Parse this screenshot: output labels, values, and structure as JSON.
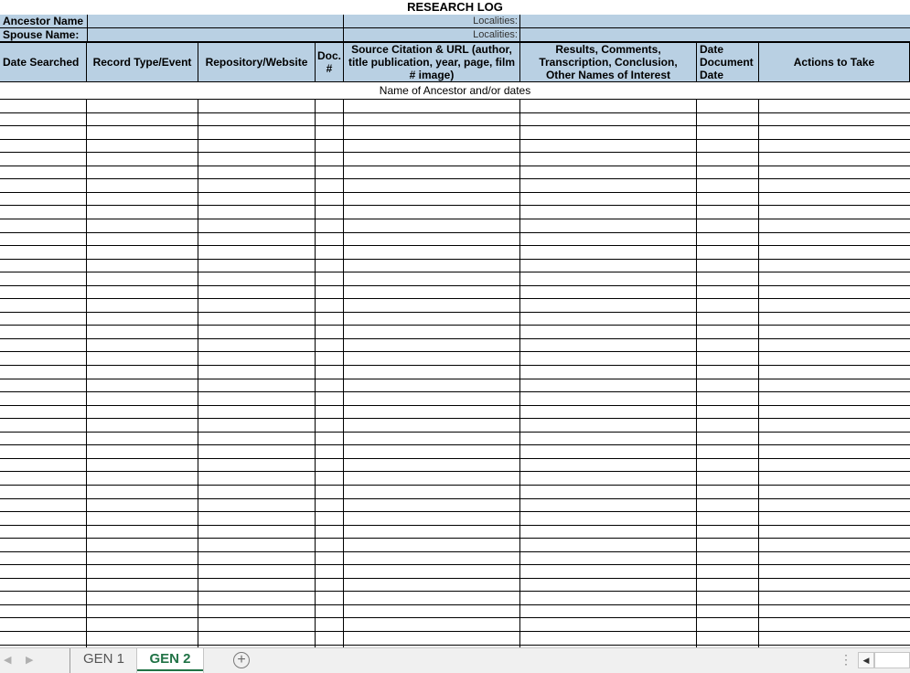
{
  "sheet": {
    "title": "RESEARCH LOG",
    "ancestor_label": "Ancestor Name",
    "spouse_label": "Spouse Name:",
    "localities_label_1": "Localities:",
    "localities_label_2": "Localities:",
    "columns": [
      "Date Searched",
      "Record Type/Event",
      "Repository/Website",
      "Doc. #",
      "Source Citation & URL (author, title publication, year, page, film # image)",
      "Results, Comments, Transcription, Conclusion, Other Names of Interest",
      "Date Document Date",
      "Actions to Take"
    ],
    "name_row": "Name of Ancestor and/or dates"
  },
  "tabs": {
    "sheets": [
      "GEN 1",
      "GEN 2"
    ],
    "active": "GEN 2",
    "add_symbol": "+",
    "nav_prev": "◀",
    "nav_next": "▶",
    "more": "⋮"
  },
  "colors": {
    "header_fill": "#b9d0e3",
    "active_tab": "#217346"
  }
}
